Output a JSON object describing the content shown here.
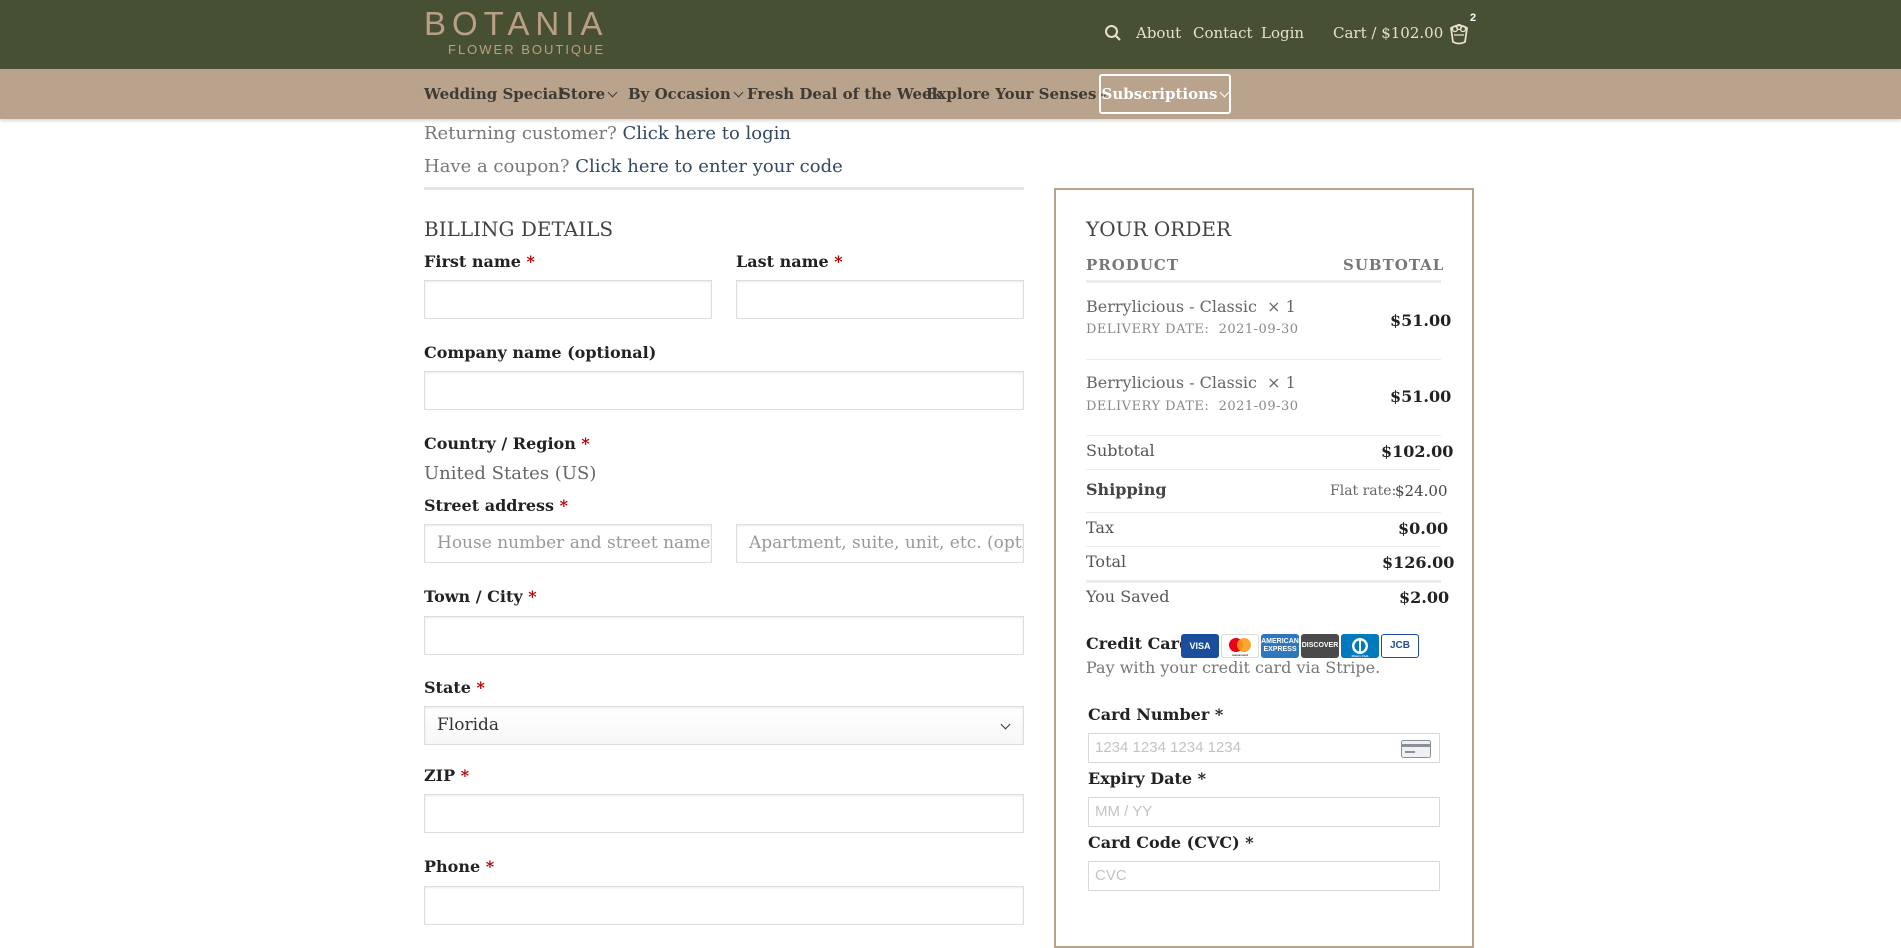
{
  "header": {
    "logo_main": "BOTANIA",
    "logo_sub": "FLOWER BOUTIQUE",
    "links": [
      "About",
      "Contact",
      "Login"
    ],
    "cart_label": "Cart / $102.00",
    "cart_count": "2",
    "icons": {
      "search": "search-icon",
      "cart": "cart-icon"
    }
  },
  "nav": {
    "items": [
      "Wedding Special",
      "Store",
      "By Occasion",
      "Fresh Deal of the Week",
      "Explore Your Senses",
      "Subscriptions"
    ]
  },
  "notices": {
    "returning_text": "Returning customer?",
    "returning_link": "Click here to login",
    "coupon_text": "Have a coupon?",
    "coupon_link": "Click here to enter your code"
  },
  "billing": {
    "title": "BILLING DETAILS",
    "first_name": "First name",
    "last_name": "Last name",
    "company": "Company name (optional)",
    "country_label": "Country / Region",
    "country_value": "United States (US)",
    "street_label": "Street address",
    "street_ph1": "House number and street name",
    "street_ph2": "Apartment, suite, unit, etc. (optional)",
    "city_label": "Town / City",
    "state_label": "State",
    "state_value": "Florida",
    "zip_label": "ZIP",
    "phone_label": "Phone",
    "required_mark": "*"
  },
  "order": {
    "title": "YOUR ORDER",
    "col_product": "PRODUCT",
    "col_subtotal": "SUBTOTAL",
    "items": [
      {
        "name": "Berrylicious - Classic",
        "qty": "× 1",
        "delivery_label": "DELIVERY DATE:",
        "delivery_date": "2021-09-30",
        "price": "$51.00"
      },
      {
        "name": "Berrylicious - Classic",
        "qty": "× 1",
        "delivery_label": "DELIVERY DATE:",
        "delivery_date": "2021-09-30",
        "price": "$51.00"
      }
    ],
    "subtotal_label": "Subtotal",
    "subtotal_value": "$102.00",
    "shipping_label": "Shipping",
    "shipping_method": "Flat rate:",
    "shipping_value": "$24.00",
    "tax_label": "Tax",
    "tax_value": "$0.00",
    "total_label": "Total",
    "total_value": "$126.00",
    "saved_label": "You Saved",
    "saved_value": "$2.00"
  },
  "payment": {
    "method_label": "Credit Card",
    "method_desc": "Pay with your credit card via Stripe.",
    "card_logos": [
      "VISA",
      "mastercard",
      "AMERICAN EXPRESS",
      "DISCOVER",
      "Diners Club",
      "JCB"
    ],
    "card_number_label": "Card Number *",
    "card_number_ph": "1234 1234 1234 1234",
    "expiry_label": "Expiry Date *",
    "expiry_ph": "MM / YY",
    "cvc_label": "Card Code (CVC) *",
    "cvc_ph": "CVC"
  },
  "colors": {
    "header_bg": "#485033",
    "nav_bg": "#baa38d",
    "accent": "#b9a084",
    "link": "#334862",
    "required": "#b20000"
  }
}
